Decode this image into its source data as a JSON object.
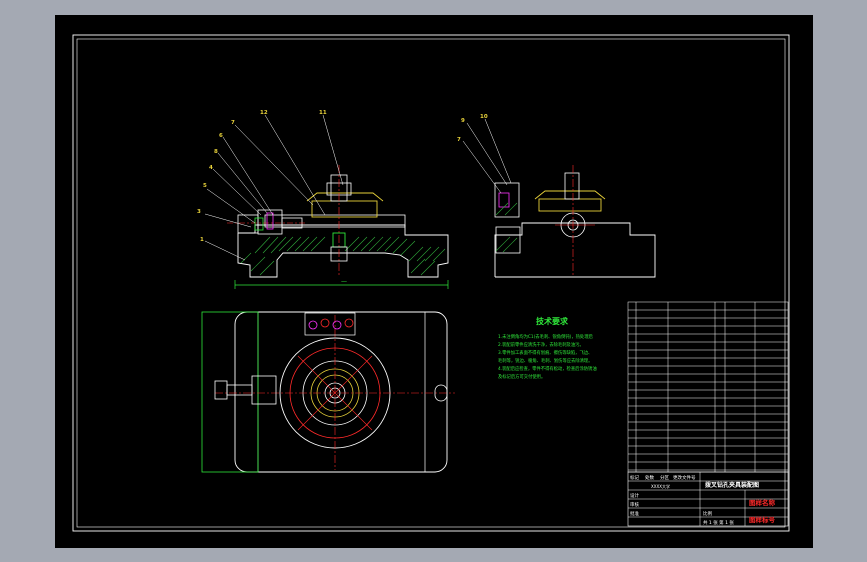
{
  "drawing": {
    "callouts": {
      "c1": "1",
      "c2": "2",
      "c3": "3",
      "c4": "4",
      "c5": "5",
      "c6": "6",
      "c7": "7",
      "c8": "8",
      "c9": "9",
      "c10": "10",
      "c11": "11",
      "c12": "12"
    },
    "dimension_text": "—",
    "tech_requirements": {
      "title": "技术要求",
      "lines": [
        "1.未注倒角均为C1(去毛刺、锐角倒钝)，热处理后",
        "2.装配前零件应清洗干净，去除毛刺及油污。",
        "3.零件加工表面不得有划痕、擦伤等缺陷，飞边、",
        "毛刺等，锐边、棱角、毛刺、划伤等应去除清理。",
        "4.装配后应检查，零件不得有松动，检查后涂防锈油",
        "及标记后方可交付使用。"
      ]
    },
    "title_block": {
      "drawing_title": "拨叉钻孔夹具装配图",
      "school_name": "XXXX大学",
      "drawing_number": "图样标号",
      "company_name": "图样名称",
      "scale_label": "比例",
      "sheet_info": "共 1 张 第 1 张",
      "design_label": "设计",
      "check_label": "审核",
      "approve_label": "批准",
      "small_labels": [
        "标记",
        "处数",
        "分区",
        "更改文件号",
        "签名",
        "年月日"
      ]
    }
  }
}
